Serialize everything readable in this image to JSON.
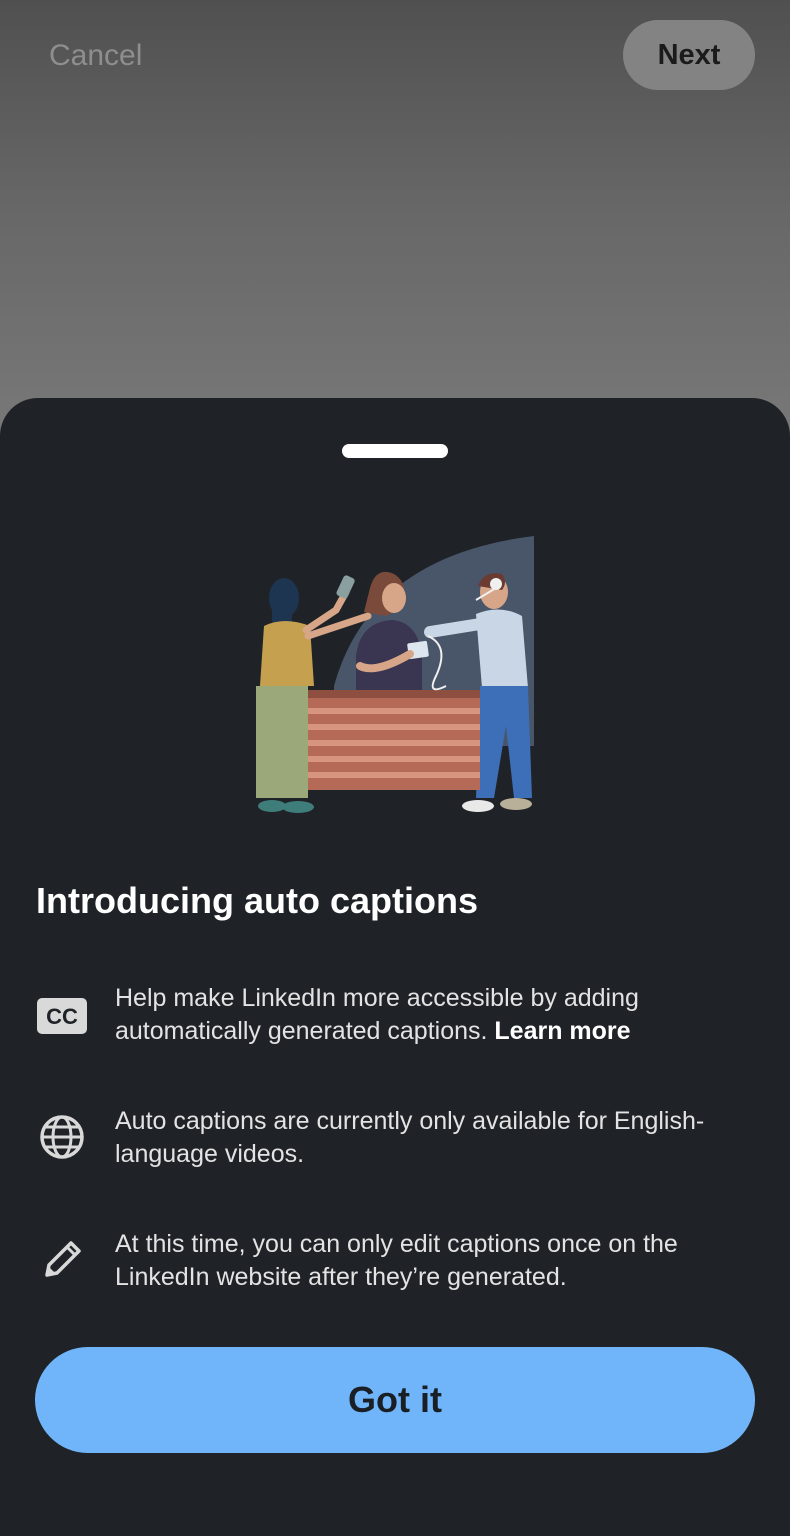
{
  "header": {
    "cancel_label": "Cancel",
    "next_label": "Next"
  },
  "sheet": {
    "title": "Introducing auto captions",
    "items": [
      {
        "icon": "cc-icon",
        "text": "Help make LinkedIn more accessible by adding automatically generated captions.",
        "link_label": "Learn more"
      },
      {
        "icon": "globe-icon",
        "text": "Auto captions are currently only available for English-language videos."
      },
      {
        "icon": "pencil-icon",
        "text": "At this time, you can only edit captions once on the LinkedIn website after they’re generated."
      }
    ],
    "primary_button_label": "Got it"
  },
  "colors": {
    "sheet_background": "#1f2327",
    "primary_button": "#70b5f9",
    "backdrop": "#676767"
  }
}
